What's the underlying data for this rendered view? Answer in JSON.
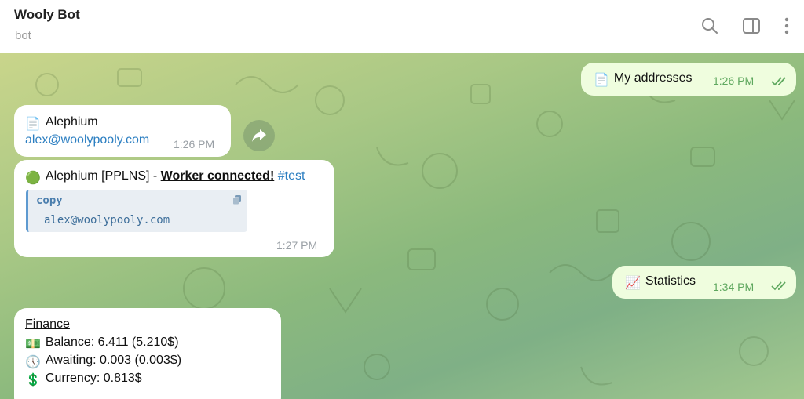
{
  "header": {
    "title": "Wooly Bot",
    "subtitle": "bot"
  },
  "messages": {
    "my_addresses": {
      "emoji": "📄",
      "text": "My addresses",
      "time": "1:26 PM"
    },
    "alephium": {
      "emoji": "📄",
      "title": "Alephium",
      "email": "alex@woolypooly.com",
      "time": "1:26 PM"
    },
    "worker": {
      "emoji": "🟢",
      "prefix": "Alephium [PPLNS] - ",
      "bold": "Worker connected!",
      "tag": "#test",
      "code_lang": "copy",
      "code_text": "alex@woolypooly.com",
      "time": "1:27 PM"
    },
    "statistics": {
      "emoji": "📈",
      "text": "Statistics",
      "time": "1:34 PM"
    },
    "finance": {
      "title": "Finance",
      "lines": [
        {
          "emoji": "💵",
          "text": "Balance: 6.411 (5.210$)"
        },
        {
          "emoji": "🕔",
          "text": "Awaiting: 0.003 (0.003$)"
        },
        {
          "emoji": "💲",
          "text": "Currency: 0.813$"
        }
      ]
    }
  },
  "colors": {
    "incoming_bubble": "#ffffff",
    "outgoing_bubble": "#effdde",
    "link": "#2b7ec1",
    "outgoing_time": "#5fa85f"
  },
  "icons": [
    "search-icon",
    "sidebar-toggle-icon",
    "more-vertical-icon",
    "share-arrow-icon",
    "copy-icon",
    "double-check-icon"
  ]
}
